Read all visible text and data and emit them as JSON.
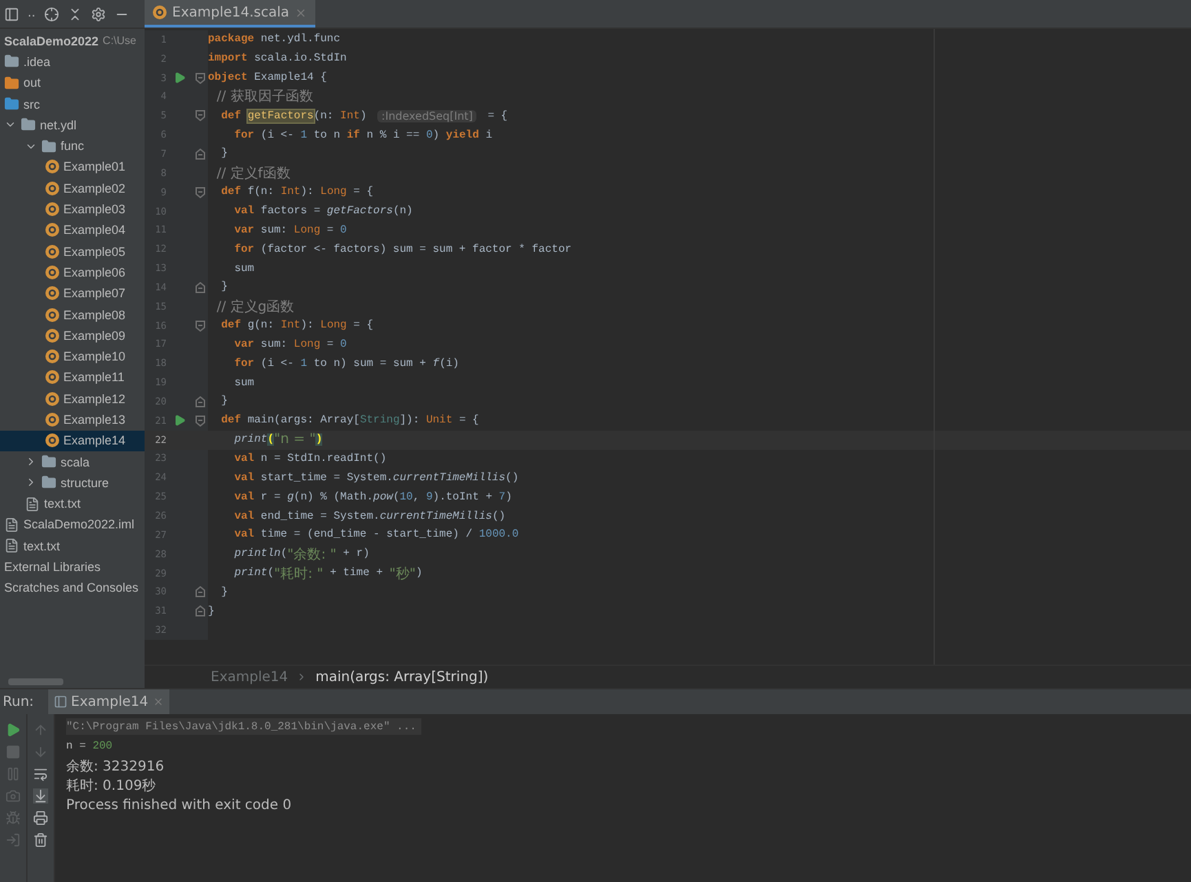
{
  "project_toolbar": {
    "view_label": ".."
  },
  "editor_tabs": [
    {
      "label": "Example14.scala",
      "selected": true
    }
  ],
  "project_tree": [
    {
      "label": "ScalaDemo2022",
      "hint": "C:\\Use",
      "kind": "project",
      "selected": false
    },
    {
      "label": ".idea",
      "kind": "folder",
      "color": "#8c9ba5",
      "selected": false
    },
    {
      "label": "out",
      "kind": "folder",
      "color": "#d4812f",
      "selected": false
    },
    {
      "label": "src",
      "kind": "folder",
      "color": "#3d8ec9",
      "selected": false
    },
    {
      "label": "net.ydl",
      "kind": "package",
      "selected": false,
      "expanded": true,
      "children": [
        {
          "label": "func",
          "kind": "package",
          "selected": false,
          "expanded": true,
          "children": [
            {
              "label": "Example01",
              "kind": "object",
              "selected": false
            },
            {
              "label": "Example02",
              "kind": "object",
              "selected": false
            },
            {
              "label": "Example03",
              "kind": "object",
              "selected": false
            },
            {
              "label": "Example04",
              "kind": "object",
              "selected": false
            },
            {
              "label": "Example05",
              "kind": "object",
              "selected": false
            },
            {
              "label": "Example06",
              "kind": "object",
              "selected": false
            },
            {
              "label": "Example07",
              "kind": "object",
              "selected": false
            },
            {
              "label": "Example08",
              "kind": "object",
              "selected": false
            },
            {
              "label": "Example09",
              "kind": "object",
              "selected": false
            },
            {
              "label": "Example10",
              "kind": "object",
              "selected": false
            },
            {
              "label": "Example11",
              "kind": "object",
              "selected": false
            },
            {
              "label": "Example12",
              "kind": "object",
              "selected": false
            },
            {
              "label": "Example13",
              "kind": "object",
              "selected": false
            },
            {
              "label": "Example14",
              "kind": "object",
              "selected": true
            }
          ]
        },
        {
          "label": "scala",
          "kind": "package",
          "selected": false,
          "expanded": false
        },
        {
          "label": "structure",
          "kind": "package",
          "selected": false,
          "expanded": false
        },
        {
          "label": "text.txt",
          "kind": "file",
          "selected": false
        }
      ]
    },
    {
      "label": "ScalaDemo2022.iml",
      "kind": "file",
      "selected": false
    },
    {
      "label": "text.txt",
      "kind": "file",
      "selected": false
    },
    {
      "label": "External Libraries",
      "kind": "plain",
      "selected": false
    },
    {
      "label": "Scratches and Consoles",
      "kind": "plain",
      "selected": false
    }
  ],
  "code_lines": [
    {
      "number": "1",
      "run": false,
      "current": false,
      "fold_open": false,
      "fold_close": false,
      "tokens": [
        {
          "kind": "kw",
          "text": "package "
        },
        {
          "kind": "id",
          "text": "net.ydl.func"
        }
      ]
    },
    {
      "number": "2",
      "run": false,
      "current": false,
      "fold_open": false,
      "fold_close": false,
      "tokens": [
        {
          "kind": "kw",
          "text": "import "
        },
        {
          "kind": "id",
          "text": "scala.io.StdIn"
        }
      ]
    },
    {
      "number": "3",
      "run": true,
      "current": false,
      "fold_open": true,
      "fold_close": false,
      "tokens": [
        {
          "kind": "kw",
          "text": "object "
        },
        {
          "kind": "id",
          "text": "Example14 {"
        }
      ]
    },
    {
      "number": "4",
      "run": false,
      "current": false,
      "fold_open": false,
      "fold_close": false,
      "tokens": [
        {
          "kind": "cm",
          "text": "  // 获取因子函数"
        }
      ]
    },
    {
      "number": "5",
      "run": false,
      "current": false,
      "fold_open": true,
      "fold_close": false,
      "tokens": [
        {
          "kind": "kw",
          "text": "  def "
        },
        {
          "kind": "mark",
          "text": "getFactors"
        },
        {
          "kind": "id",
          "text": "(n: "
        },
        {
          "kind": "type",
          "text": "Int"
        },
        {
          "kind": "id",
          "text": ") "
        },
        {
          "kind": "hint",
          "text": ":IndexedSeq[Int]"
        },
        {
          "kind": "id",
          "text": " = {"
        }
      ]
    },
    {
      "number": "6",
      "run": false,
      "current": false,
      "fold_open": false,
      "fold_close": false,
      "tokens": [
        {
          "kind": "kw",
          "text": "    for "
        },
        {
          "kind": "id",
          "text": "(i <- "
        },
        {
          "kind": "num",
          "text": "1"
        },
        {
          "kind": "id",
          "text": " to n "
        },
        {
          "kind": "kw",
          "text": "if "
        },
        {
          "kind": "id",
          "text": "n % i == "
        },
        {
          "kind": "num",
          "text": "0"
        },
        {
          "kind": "id",
          "text": ") "
        },
        {
          "kind": "kw",
          "text": "yield "
        },
        {
          "kind": "id",
          "text": "i"
        }
      ]
    },
    {
      "number": "7",
      "run": false,
      "current": false,
      "fold_open": false,
      "fold_close": true,
      "tokens": [
        {
          "kind": "id",
          "text": "  }"
        }
      ]
    },
    {
      "number": "8",
      "run": false,
      "current": false,
      "fold_open": false,
      "fold_close": false,
      "tokens": [
        {
          "kind": "cm",
          "text": "  // 定义f函数"
        }
      ]
    },
    {
      "number": "9",
      "run": false,
      "current": false,
      "fold_open": true,
      "fold_close": false,
      "tokens": [
        {
          "kind": "kw",
          "text": "  def "
        },
        {
          "kind": "id",
          "text": "f(n: "
        },
        {
          "kind": "type",
          "text": "Int"
        },
        {
          "kind": "id",
          "text": "): "
        },
        {
          "kind": "type",
          "text": "Long"
        },
        {
          "kind": "id",
          "text": " = {"
        }
      ]
    },
    {
      "number": "10",
      "run": false,
      "current": false,
      "fold_open": false,
      "fold_close": false,
      "tokens": [
        {
          "kind": "kw",
          "text": "    val "
        },
        {
          "kind": "id",
          "text": "factors = "
        },
        {
          "kind": "it",
          "text": "getFactors"
        },
        {
          "kind": "id",
          "text": "(n)"
        }
      ]
    },
    {
      "number": "11",
      "run": false,
      "current": false,
      "fold_open": false,
      "fold_close": false,
      "tokens": [
        {
          "kind": "kw",
          "text": "    var "
        },
        {
          "kind": "id",
          "text": "sum: "
        },
        {
          "kind": "type",
          "text": "Long"
        },
        {
          "kind": "id",
          "text": " = "
        },
        {
          "kind": "num",
          "text": "0"
        }
      ]
    },
    {
      "number": "12",
      "run": false,
      "current": false,
      "fold_open": false,
      "fold_close": false,
      "tokens": [
        {
          "kind": "kw",
          "text": "    for "
        },
        {
          "kind": "id",
          "text": "(factor <- factors) sum = sum + factor * factor"
        }
      ]
    },
    {
      "number": "13",
      "run": false,
      "current": false,
      "fold_open": false,
      "fold_close": false,
      "tokens": [
        {
          "kind": "id",
          "text": "    sum"
        }
      ]
    },
    {
      "number": "14",
      "run": false,
      "current": false,
      "fold_open": false,
      "fold_close": true,
      "tokens": [
        {
          "kind": "id",
          "text": "  }"
        }
      ]
    },
    {
      "number": "15",
      "run": false,
      "current": false,
      "fold_open": false,
      "fold_close": false,
      "tokens": [
        {
          "kind": "cm",
          "text": "  // 定义g函数"
        }
      ]
    },
    {
      "number": "16",
      "run": false,
      "current": false,
      "fold_open": true,
      "fold_close": false,
      "tokens": [
        {
          "kind": "kw",
          "text": "  def "
        },
        {
          "kind": "id",
          "text": "g(n: "
        },
        {
          "kind": "type",
          "text": "Int"
        },
        {
          "kind": "id",
          "text": "): "
        },
        {
          "kind": "type",
          "text": "Long"
        },
        {
          "kind": "id",
          "text": " = {"
        }
      ]
    },
    {
      "number": "17",
      "run": false,
      "current": false,
      "fold_open": false,
      "fold_close": false,
      "tokens": [
        {
          "kind": "kw",
          "text": "    var "
        },
        {
          "kind": "id",
          "text": "sum: "
        },
        {
          "kind": "type",
          "text": "Long"
        },
        {
          "kind": "id",
          "text": " = "
        },
        {
          "kind": "num",
          "text": "0"
        }
      ]
    },
    {
      "number": "18",
      "run": false,
      "current": false,
      "fold_open": false,
      "fold_close": false,
      "tokens": [
        {
          "kind": "kw",
          "text": "    for "
        },
        {
          "kind": "id",
          "text": "(i <- "
        },
        {
          "kind": "num",
          "text": "1"
        },
        {
          "kind": "id",
          "text": " to n) sum = sum + "
        },
        {
          "kind": "it",
          "text": "f"
        },
        {
          "kind": "id",
          "text": "(i)"
        }
      ]
    },
    {
      "number": "19",
      "run": false,
      "current": false,
      "fold_open": false,
      "fold_close": false,
      "tokens": [
        {
          "kind": "id",
          "text": "    sum"
        }
      ]
    },
    {
      "number": "20",
      "run": false,
      "current": false,
      "fold_open": false,
      "fold_close": true,
      "tokens": [
        {
          "kind": "id",
          "text": "  }"
        }
      ]
    },
    {
      "number": "21",
      "run": true,
      "current": false,
      "fold_open": true,
      "fold_close": false,
      "tokens": [
        {
          "kind": "kw",
          "text": "  def "
        },
        {
          "kind": "id",
          "text": "main(args: Array["
        },
        {
          "kind": "type2",
          "text": "String"
        },
        {
          "kind": "id",
          "text": "]): "
        },
        {
          "kind": "type",
          "text": "Unit"
        },
        {
          "kind": "id",
          "text": " = {"
        }
      ]
    },
    {
      "number": "22",
      "run": false,
      "current": true,
      "fold_open": false,
      "fold_close": false,
      "tokens": [
        {
          "kind": "it",
          "text": "    print"
        },
        {
          "kind": "brace",
          "text": "("
        },
        {
          "kind": "str",
          "text": "\"n = \""
        },
        {
          "kind": "brace",
          "text": ")"
        }
      ]
    },
    {
      "number": "23",
      "run": false,
      "current": false,
      "fold_open": false,
      "fold_close": false,
      "tokens": [
        {
          "kind": "kw",
          "text": "    val "
        },
        {
          "kind": "id",
          "text": "n = StdIn.readInt()"
        }
      ]
    },
    {
      "number": "24",
      "run": false,
      "current": false,
      "fold_open": false,
      "fold_close": false,
      "tokens": [
        {
          "kind": "kw",
          "text": "    val "
        },
        {
          "kind": "id",
          "text": "start_time = System."
        },
        {
          "kind": "it",
          "text": "currentTimeMillis"
        },
        {
          "kind": "id",
          "text": "()"
        }
      ]
    },
    {
      "number": "25",
      "run": false,
      "current": false,
      "fold_open": false,
      "fold_close": false,
      "tokens": [
        {
          "kind": "kw",
          "text": "    val "
        },
        {
          "kind": "id",
          "text": "r = "
        },
        {
          "kind": "it",
          "text": "g"
        },
        {
          "kind": "id",
          "text": "(n) % (Math."
        },
        {
          "kind": "it",
          "text": "pow"
        },
        {
          "kind": "id",
          "text": "("
        },
        {
          "kind": "num",
          "text": "10"
        },
        {
          "kind": "id",
          "text": ", "
        },
        {
          "kind": "num",
          "text": "9"
        },
        {
          "kind": "id",
          "text": ").toInt + "
        },
        {
          "kind": "num",
          "text": "7"
        },
        {
          "kind": "id",
          "text": ")"
        }
      ]
    },
    {
      "number": "26",
      "run": false,
      "current": false,
      "fold_open": false,
      "fold_close": false,
      "tokens": [
        {
          "kind": "kw",
          "text": "    val "
        },
        {
          "kind": "id",
          "text": "end_time = System."
        },
        {
          "kind": "it",
          "text": "currentTimeMillis"
        },
        {
          "kind": "id",
          "text": "()"
        }
      ]
    },
    {
      "number": "27",
      "run": false,
      "current": false,
      "fold_open": false,
      "fold_close": false,
      "tokens": [
        {
          "kind": "kw",
          "text": "    val "
        },
        {
          "kind": "id",
          "text": "time = (end_time - start_time) / "
        },
        {
          "kind": "num",
          "text": "1000.0"
        }
      ]
    },
    {
      "number": "28",
      "run": false,
      "current": false,
      "fold_open": false,
      "fold_close": false,
      "tokens": [
        {
          "kind": "it",
          "text": "    println"
        },
        {
          "kind": "id",
          "text": "("
        },
        {
          "kind": "str",
          "text": "\"余数: \""
        },
        {
          "kind": "id",
          "text": " + r)"
        }
      ]
    },
    {
      "number": "29",
      "run": false,
      "current": false,
      "fold_open": false,
      "fold_close": false,
      "tokens": [
        {
          "kind": "it",
          "text": "    print"
        },
        {
          "kind": "id",
          "text": "("
        },
        {
          "kind": "str",
          "text": "\"耗时: \""
        },
        {
          "kind": "id",
          "text": " + time + "
        },
        {
          "kind": "str",
          "text": "\"秒\""
        },
        {
          "kind": "id",
          "text": ")"
        }
      ]
    },
    {
      "number": "30",
      "run": false,
      "current": false,
      "fold_open": false,
      "fold_close": true,
      "tokens": [
        {
          "kind": "id",
          "text": "  }"
        }
      ]
    },
    {
      "number": "31",
      "run": false,
      "current": false,
      "fold_open": false,
      "fold_close": true,
      "tokens": [
        {
          "kind": "id",
          "text": "}"
        }
      ]
    },
    {
      "number": "32",
      "run": false,
      "current": false,
      "fold_open": false,
      "fold_close": false
    }
  ],
  "breadcrumbs": [
    "Example14",
    "main(args: Array[String])"
  ],
  "run_panel": {
    "label": "Run:",
    "tabs": [
      {
        "label": "Example14",
        "selected": true
      }
    ],
    "console": [
      {
        "kind": "command",
        "text": "\"C:\\Program Files\\Java\\jdk1.8.0_281\\bin\\java.exe\" ..."
      },
      {
        "kind": "input",
        "text": "n = ",
        "input": "200"
      },
      {
        "kind": "output",
        "text": "余数: 3232916"
      },
      {
        "kind": "output",
        "text": "耗时: 0.109秒"
      },
      {
        "kind": "output",
        "text": "Process finished with exit code 0"
      }
    ]
  }
}
